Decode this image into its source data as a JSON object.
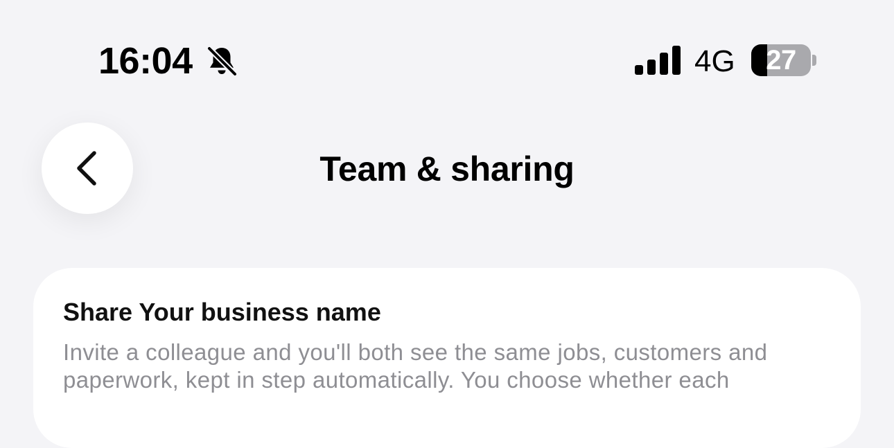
{
  "status_bar": {
    "time": "16:04",
    "silent_icon": "bell-slash-icon",
    "signal_icon": "cellular-signal-icon",
    "network": "4G",
    "battery_level": "27",
    "battery_fraction": 0.27
  },
  "header": {
    "back_icon": "chevron-left-icon",
    "title": "Team & sharing"
  },
  "card": {
    "title": "Share Your business name",
    "description": "Invite a colleague and you'll both see the same jobs, customers and paperwork, kept in step automatically. You choose whether each"
  },
  "colors": {
    "background": "#f4f4f7",
    "card": "#ffffff",
    "secondary_text": "#8e8e93",
    "battery_track": "#a9a9ad"
  }
}
